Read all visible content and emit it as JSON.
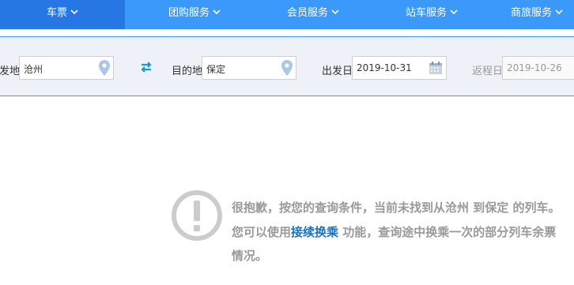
{
  "nav": {
    "items": [
      {
        "label": "车票",
        "active": true
      },
      {
        "label": "团购服务",
        "active": false
      },
      {
        "label": "会员服务",
        "active": false
      },
      {
        "label": "站车服务",
        "active": false
      },
      {
        "label": "商旅服务",
        "active": false
      }
    ]
  },
  "search": {
    "from_label": "发地",
    "from_value": "沧州",
    "to_label": "目的地",
    "to_value": "保定",
    "depart_label": "出发日",
    "depart_value": "2019-10-31",
    "return_label": "返程日",
    "return_value": "2019-10-26",
    "icons": {
      "from": "location-pin-icon",
      "to": "location-pin-icon",
      "swap": "swap-icon",
      "calendar": "calendar-icon"
    }
  },
  "notice": {
    "icon": "exclamation-circle-icon",
    "text_before": "很抱歉，按您的查询条件，当前未找到从沧州 到保定 的列车。您可以使用",
    "link_label": "接续换乘",
    "text_after": " 功能，查询途中换乘一次的部分列车余票情况。"
  },
  "colors": {
    "nav_bg": "#3b99fc",
    "nav_active": "#2676e3",
    "search_bg": "#eef1f8",
    "link": "#1a71c2",
    "swap_icon": "#1a9bd7"
  }
}
